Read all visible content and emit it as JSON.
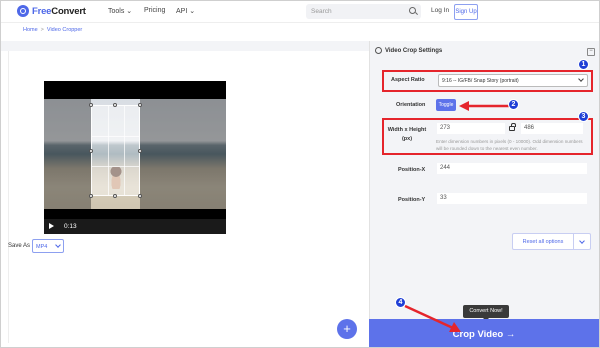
{
  "nav": {
    "logo_free": "Free",
    "logo_convert": "Convert",
    "tools": "Tools",
    "pricing": "Pricing",
    "api": "API",
    "search_placeholder": "Search",
    "login": "Log In",
    "signup": "Sign Up"
  },
  "breadcrumb": {
    "home": "Home",
    "sep": ">",
    "current": "Video Cropper"
  },
  "player": {
    "time": "0:13"
  },
  "save_as": {
    "label": "Save As",
    "value": "MP4"
  },
  "settings": {
    "title": "Video Crop Settings",
    "aspect_ratio_label": "Aspect Ratio",
    "aspect_ratio_value": "9:16 -- IG/FB/ Snap Story (portrait)",
    "orientation_label": "Orientation",
    "toggle_label": "Toggle",
    "wh_label_1": "Width x Height",
    "wh_label_2": "(px)",
    "width_value": "273",
    "height_value": "486",
    "help_text": "Enter dimension numbers in pixels (0 - 10000). Odd dimension numbers will be rounded down to the nearest even number.",
    "position_x_label": "Position-X",
    "position_x_value": "244",
    "position_y_label": "Position-Y",
    "position_y_value": "33",
    "reset_label": "Reset all options"
  },
  "convert_tooltip": "Convert Now!",
  "crop_button": "Crop Video",
  "fab_label": "+",
  "annotations": {
    "badges": [
      "1",
      "2",
      "3",
      "4"
    ],
    "color": "#e5252c",
    "badge_color": "#1f3fd6"
  },
  "colors": {
    "accent": "#5d72ea",
    "brand": "#4e68e8"
  }
}
